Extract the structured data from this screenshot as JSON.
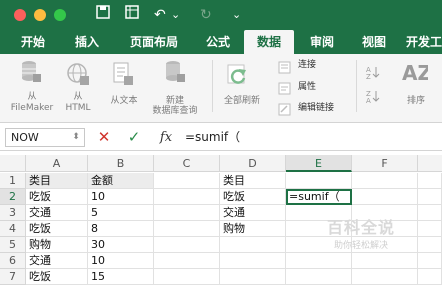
{
  "window": {
    "traffic_lights": [
      "#fc605c",
      "#fdbc40",
      "#34c84a"
    ],
    "quick_access": {
      "save_icon": "save-icon",
      "undo_glyph": "↶",
      "redo_glyph": "↻",
      "more_glyph": "⌄"
    }
  },
  "tabs": [
    "开始",
    "插入",
    "页面布局",
    "公式",
    "数据",
    "审阅",
    "视图",
    "开发工"
  ],
  "active_tab": "数据",
  "ribbon": {
    "filemaker": "从\nFileMaker",
    "html": "从\nHTML",
    "text": "从文本",
    "new_db_query": "新建\n数据库查询",
    "refresh_all": "全部刷新",
    "connections": "连接",
    "properties": "属性",
    "edit_links": "编辑链接",
    "sort": "排序"
  },
  "formula_bar": {
    "name_box": "NOW",
    "cancel": "✕",
    "enter": "✓",
    "fx": "fx",
    "formula": "=sumif（"
  },
  "grid": {
    "columns": [
      "A",
      "B",
      "C",
      "D",
      "E",
      "F"
    ],
    "selected_column": "E",
    "rows": [
      "1",
      "2",
      "3",
      "4",
      "5",
      "6",
      "7"
    ],
    "selected_row": "2",
    "cells": {
      "A1": "类目",
      "B1": "金额",
      "D1": "类目",
      "A2": "吃饭",
      "B2": "10",
      "D2": "吃饭",
      "E2": "=sumif（",
      "A3": "交通",
      "B3": "5",
      "D3": "交通",
      "A4": "吃饭",
      "B4": "8",
      "D4": "购物",
      "A5": "购物",
      "B5": "30",
      "A6": "交通",
      "B6": "10",
      "A7": "吃饭",
      "B7": "15"
    }
  },
  "watermark": {
    "title": "百科全说",
    "subtitle": "助你轻松解决"
  },
  "colors": {
    "excel_green": "#1e7145",
    "ribbon_bg": "#f5f5f5",
    "cancel_red": "#d0342c",
    "enter_green": "#2a8c4a"
  }
}
